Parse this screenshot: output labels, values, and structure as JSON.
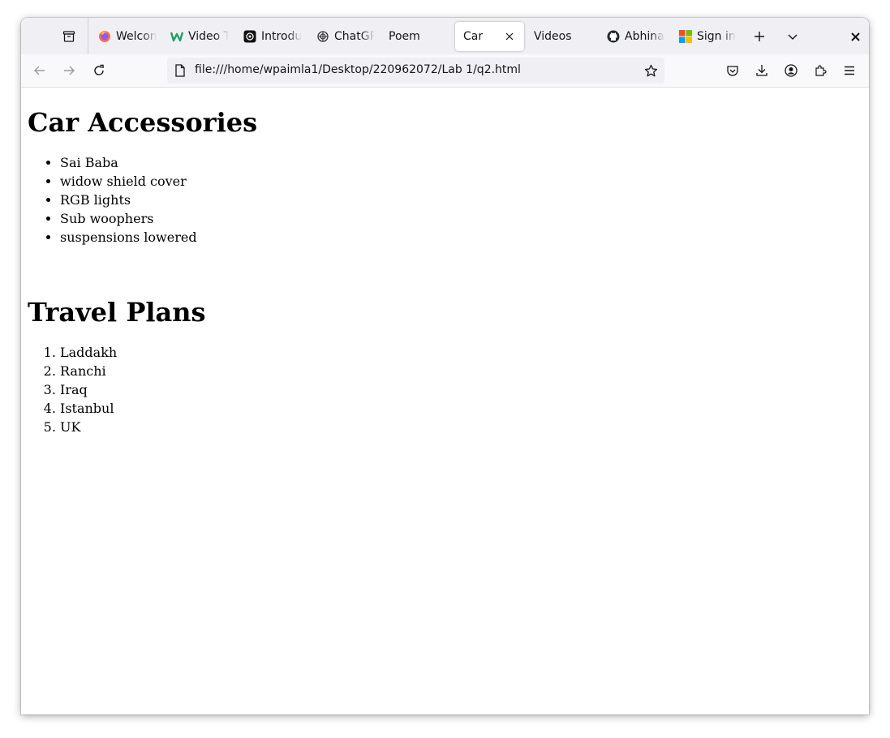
{
  "browser": {
    "tabs": [
      {
        "label": "Welcome",
        "icon": "firefox-icon"
      },
      {
        "label": "Video T",
        "icon": "wikipedia-w-icon"
      },
      {
        "label": "Introdu",
        "icon": "openai-logo-icon"
      },
      {
        "label": "ChatGPT",
        "icon": "openai-logo-icon"
      },
      {
        "label": "Poem",
        "icon": ""
      },
      {
        "label": "Car",
        "icon": "",
        "active": true
      },
      {
        "label": "Videos",
        "icon": ""
      },
      {
        "label": "Abhina",
        "icon": "github-icon"
      },
      {
        "label": "Sign in",
        "icon": "microsoft-icon"
      }
    ],
    "url": "file:///home/wpaimla1/Desktop/220962072/Lab 1/q2.html"
  },
  "page": {
    "heading1": "Car Accessories",
    "accessories": [
      "Sai Baba",
      "widow shield cover",
      "RGB lights",
      "Sub woophers",
      "suspensions lowered"
    ],
    "heading2": "Travel Plans",
    "travel": [
      "Laddakh",
      "Ranchi",
      "Iraq",
      "Istanbul",
      "UK"
    ]
  }
}
